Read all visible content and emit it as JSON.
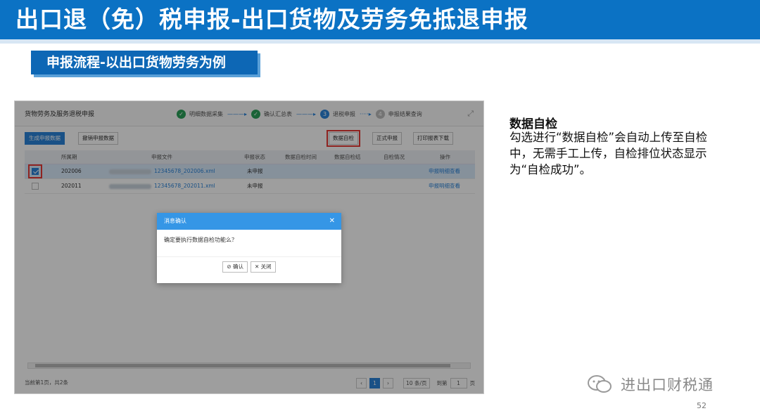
{
  "slide": {
    "title": "出口退（免）税申报-出口货物及劳务免抵退申报",
    "section": "申报流程-以出口货物劳务为例",
    "page_number": "52",
    "watermark": "进出口财税通"
  },
  "app": {
    "window_title": "货物劳务及服务退税申报",
    "steps": [
      {
        "num": "✓",
        "label": "明细数据采集",
        "state": "done"
      },
      {
        "num": "✓",
        "label": "确认汇总表",
        "state": "done"
      },
      {
        "num": "3",
        "label": "退税申报",
        "state": "current"
      },
      {
        "num": "4",
        "label": "申报结果查询",
        "state": "todo"
      }
    ],
    "toolbar": {
      "generate": "生成申报数据",
      "withdraw": "撤销申报数据",
      "self_check": "数据自检",
      "formal": "正式申报",
      "print": "打印报表下载"
    },
    "columns": [
      "所属期",
      "申报文件",
      "申报状态",
      "数据自检时间",
      "数据自检结",
      "自检情况",
      "操作"
    ],
    "rows": [
      {
        "period": "202006",
        "file": "12345678_202006.xml",
        "status": "未申报",
        "action": "申报明细查看",
        "checked": true
      },
      {
        "period": "202011",
        "file": "12345678_202011.xml",
        "status": "未申报",
        "action": "申报明细查看",
        "checked": false
      }
    ],
    "footer": {
      "summary": "当前第1页，共2条",
      "page": "1",
      "per_page": "10 条/页",
      "goto_label": "到第",
      "goto_value": "1",
      "page_suffix": "页"
    },
    "modal": {
      "title": "消息确认",
      "message": "确定要执行数据自检功能么？",
      "confirm": "确认",
      "close": "关闭"
    }
  },
  "description": {
    "title": "数据自检",
    "body": "勾选进行“数据自检”会自动上传至自检中，无需手工上传，自检排位状态显示为“自检成功”。"
  },
  "colors": {
    "title_bar": "#0b72c4",
    "ribbon": "#0d67b5",
    "accent": "#2a83d8",
    "highlight": "#e53935"
  }
}
